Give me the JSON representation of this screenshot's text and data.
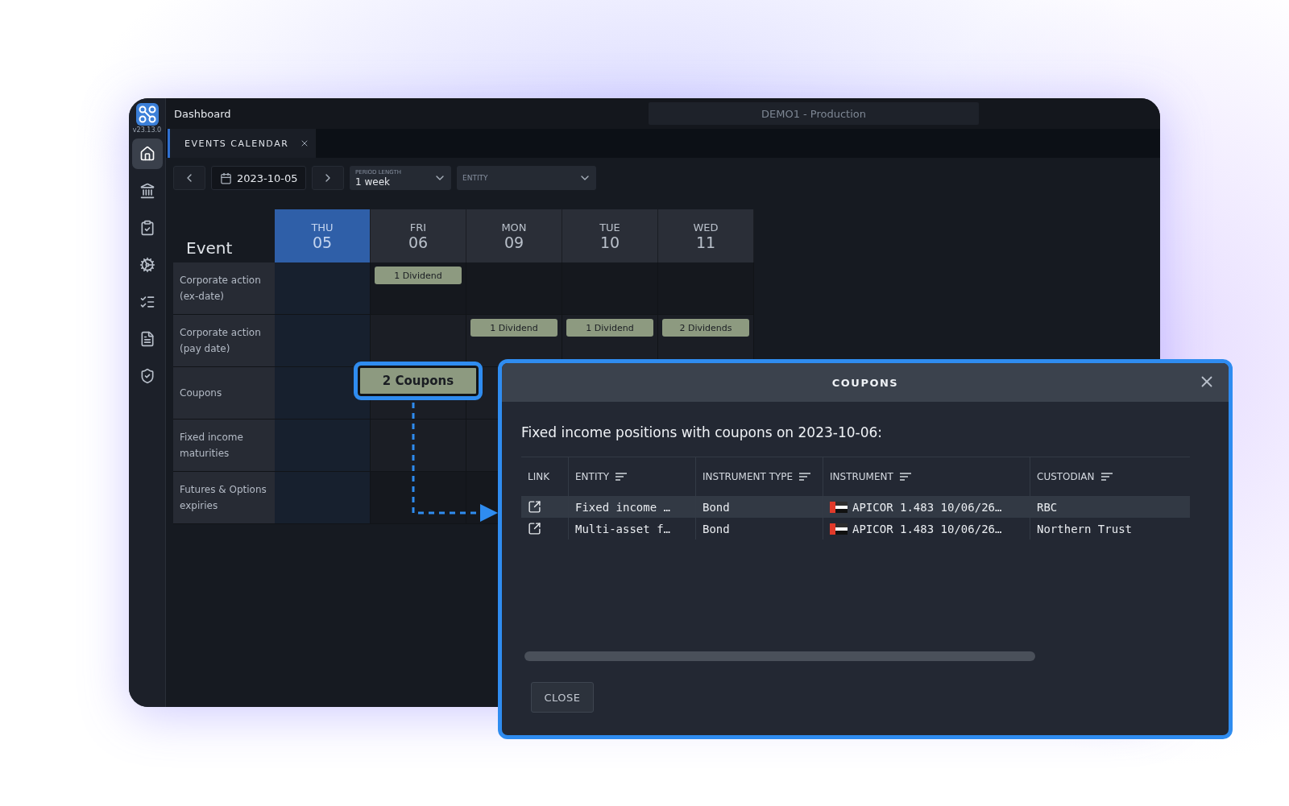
{
  "app": {
    "version": "v23.13.0",
    "title": "Dashboard",
    "environment": "DEMO1 - Production"
  },
  "sidebar": {
    "items": [
      {
        "kind": "home",
        "selected": true
      },
      {
        "kind": "bank",
        "selected": false
      },
      {
        "kind": "clipboard",
        "selected": false
      },
      {
        "kind": "gears",
        "selected": false
      },
      {
        "kind": "checklist",
        "selected": false
      },
      {
        "kind": "document",
        "selected": false
      },
      {
        "kind": "shield",
        "selected": false
      }
    ]
  },
  "tabs": [
    {
      "label": "EVENTS CALENDAR",
      "selected": true
    }
  ],
  "toolbar": {
    "date": "2023-10-05",
    "period": {
      "label": "PERIOD LENGTH",
      "value": "1 week"
    },
    "entity": {
      "placeholder": "ENTITY"
    }
  },
  "calendar": {
    "corner": "Event",
    "days": [
      {
        "weekday": "THU",
        "day": "05",
        "selected": true
      },
      {
        "weekday": "FRI",
        "day": "06",
        "selected": false
      },
      {
        "weekday": "MON",
        "day": "09",
        "selected": false
      },
      {
        "weekday": "TUE",
        "day": "10",
        "selected": false
      },
      {
        "weekday": "WED",
        "day": "11",
        "selected": false
      }
    ],
    "rows": [
      {
        "label": "Corporate action (ex-date)",
        "cells": [
          null,
          {
            "label": "1 Dividend",
            "highlighted": false
          },
          null,
          null,
          null
        ]
      },
      {
        "label": "Corporate action (pay date)",
        "cells": [
          null,
          null,
          {
            "label": "1 Dividend",
            "highlighted": false
          },
          {
            "label": "1 Dividend",
            "highlighted": false
          },
          {
            "label": "2 Dividends",
            "highlighted": false
          }
        ]
      },
      {
        "label": "Coupons",
        "cells": [
          null,
          {
            "label": "2 Coupons",
            "highlighted": true
          },
          null,
          null,
          null
        ]
      },
      {
        "label": "Fixed income maturities",
        "cells": [
          null,
          null,
          null,
          null,
          null
        ]
      },
      {
        "label": "Futures & Options expiries",
        "cells": [
          null,
          null,
          null,
          null,
          null
        ]
      }
    ]
  },
  "modal": {
    "title": "COUPONS",
    "intro": "Fixed income positions with coupons on 2023-10-06:",
    "columns": [
      {
        "kind": "plain",
        "label": "LINK"
      },
      {
        "kind": "sortable",
        "label": "ENTITY"
      },
      {
        "kind": "sortable",
        "label": "INSTRUMENT TYPE"
      },
      {
        "kind": "sortable",
        "label": "INSTRUMENT"
      },
      {
        "kind": "sortable",
        "label": "CUSTODIAN"
      }
    ],
    "rows": [
      {
        "entity": "Fixed income …",
        "type": "Bond",
        "instrument": "APICOR 1.483 10/06/26…",
        "custodian": "RBC",
        "selected": true
      },
      {
        "entity": "Multi-asset f…",
        "type": "Bond",
        "instrument": "APICOR 1.483 10/06/26…",
        "custodian": "Northern Trust",
        "selected": false
      }
    ],
    "close": "CLOSE"
  }
}
